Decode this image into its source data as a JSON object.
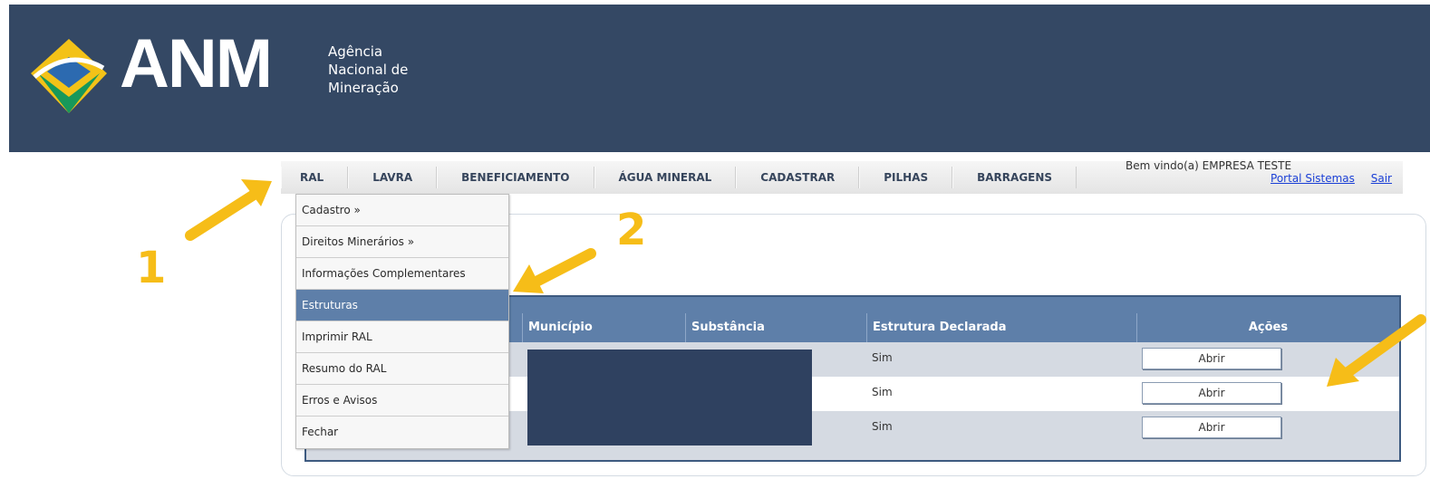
{
  "header": {
    "logo_text": "ANM",
    "logo_sub": [
      "Agência",
      "Nacional de",
      "Mineração"
    ]
  },
  "menu": {
    "items": [
      "RAL",
      "LAVRA",
      "BENEFICIAMENTO",
      "ÁGUA MINERAL",
      "CADASTRAR",
      "PILHAS",
      "BARRAGENS"
    ]
  },
  "welcome": {
    "text": "Bem vindo(a) EMPRESA TESTE",
    "portal": "Portal Sistemas",
    "sair": "Sair"
  },
  "dropdown": {
    "items": [
      "Cadastro »",
      "Direitos Minerários »",
      "Informações Complementares",
      "Estruturas",
      "Imprimir RAL",
      "Resumo do RAL",
      "Erros e Avisos",
      "Fechar"
    ],
    "active_index": 3
  },
  "table": {
    "columns": [
      "Município",
      "Substância",
      "Estrutura Declarada",
      "Ações"
    ],
    "rows": [
      {
        "estrutura": "Sim",
        "acao": "Abrir"
      },
      {
        "estrutura": "Sim",
        "acao": "Abrir"
      },
      {
        "estrutura": "Sim",
        "acao": "Abrir"
      }
    ]
  },
  "annotations": [
    "1",
    "2"
  ],
  "colors": {
    "header_bg": "#344864",
    "table_header": "#5e7fa9",
    "annotation": "#f6bd18",
    "link": "#1a3fd6"
  }
}
